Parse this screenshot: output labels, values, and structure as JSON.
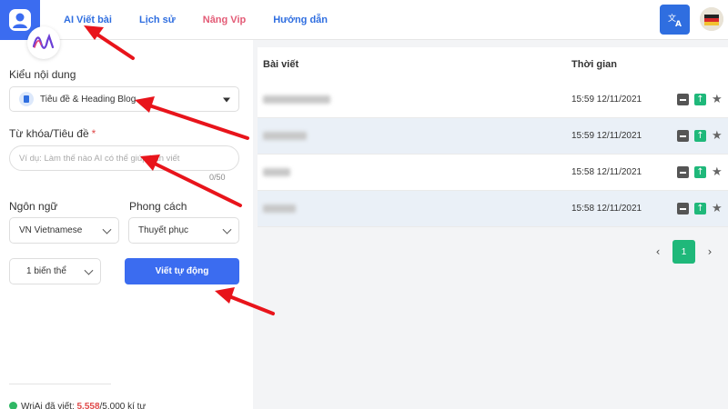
{
  "nav": {
    "items": [
      {
        "label": "AI Viết bài",
        "style": "active"
      },
      {
        "label": "Lịch sử",
        "style": "blue"
      },
      {
        "label": "Nâng Vip",
        "style": "vip"
      },
      {
        "label": "Hướng dẫn",
        "style": "blue"
      }
    ],
    "translate_icon_text": "文A"
  },
  "form": {
    "content_type_label": "Kiểu nội dung",
    "content_type_value": "Tiêu đề & Heading Blog",
    "keyword_label": "Từ khóa/Tiêu đề",
    "keyword_required": "*",
    "keyword_placeholder": "Ví dụ: Làm thế nào AI có thể giúp bạn viết",
    "keyword_counter": "0/50",
    "language_label": "Ngôn ngữ",
    "language_value": "VN Vietnamese",
    "style_label": "Phong cách",
    "style_value": "Thuyết phục",
    "variants_value": "1 biến thể",
    "submit_label": "Viết tự động"
  },
  "footer": {
    "prefix": "WriAi đã viết: ",
    "used": "5.558",
    "suffix": "/5.000 kí tự"
  },
  "table": {
    "col_title": "Bài viết",
    "col_time": "Thời gian",
    "rows": [
      {
        "time": "15:59 12/11/2021"
      },
      {
        "time": "15:59 12/11/2021"
      },
      {
        "time": "15:58 12/11/2021"
      },
      {
        "time": "15:58 12/11/2021"
      }
    ]
  },
  "pagination": {
    "prev": "‹",
    "current": "1",
    "next": "›"
  },
  "colors": {
    "primary": "#3b6cf0",
    "success": "#1fb87a",
    "vip": "#e35b76",
    "annotation_arrow": "#e8141b"
  }
}
